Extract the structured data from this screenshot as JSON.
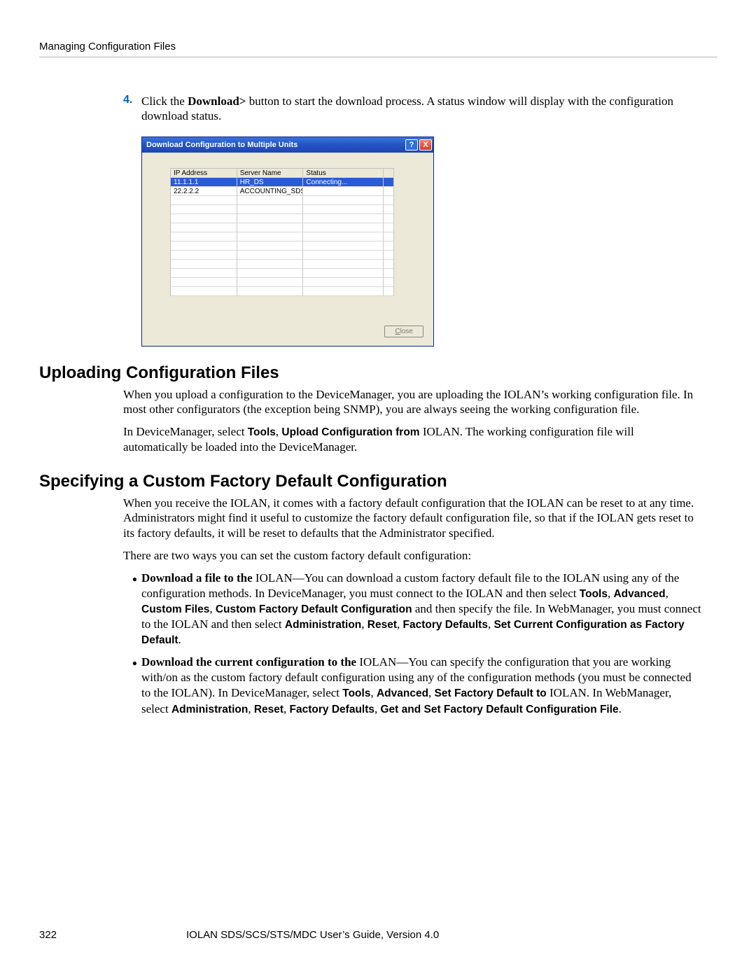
{
  "header": {
    "running": "Managing Configuration Files"
  },
  "step": {
    "num": "4.",
    "text_pre": "Click the ",
    "bold": "Download>",
    "text_post": " button to start the download process. A status window will display with the configuration download status."
  },
  "dialog": {
    "title": "Download Configuration to Multiple Units",
    "help": "?",
    "close_x": "X",
    "cols": {
      "ip": "IP Address",
      "name": "Server Name",
      "status": "Status"
    },
    "rows": [
      {
        "ip": "11.1.1.1",
        "name": "HR_DS",
        "status": "Connecting...",
        "selected": true
      },
      {
        "ip": "22.2.2.2",
        "name": "ACCOUNTING_SDS",
        "status": "",
        "selected": false
      }
    ],
    "blank_rows": 11,
    "close_btn": {
      "mnemonic": "C",
      "rest": "lose"
    }
  },
  "sections": {
    "upload": {
      "heading": "Uploading Configuration Files",
      "p1": "When you upload a configuration to the DeviceManager, you are uploading the IOLAN’s working configuration file. In most other configurators (the exception being SNMP), you are always seeing the working configuration file.",
      "p2_pre": "In DeviceManager, select ",
      "p2_b1": "Tools",
      "p2_comma": ", ",
      "p2_b2": "Upload Configuration from",
      "p2_post": " IOLAN. The working configuration file will automatically be loaded into the DeviceManager."
    },
    "custom": {
      "heading": "Specifying a Custom Factory Default Configuration",
      "p1": "When you receive the IOLAN, it comes with a factory default configuration that the IOLAN can be reset to at any time. Administrators might find it useful to customize the factory default configuration file, so that if the IOLAN gets reset to its factory defaults, it will be reset to defaults that the Administrator specified.",
      "p2": "There are two ways you can set the custom factory default configuration:",
      "bullet1": {
        "lead_b": "Download a file to the ",
        "lead_post": "IOLAN—You can download a custom factory default file to the IOLAN using any of the configuration methods. In DeviceManager, you must connect to the IOLAN and then select ",
        "m1": "Tools",
        "c": ", ",
        "m2": "Advanced",
        "m3": "Custom Files",
        "m4": "Custom Factory Default Configuration",
        "mid": " and then specify the file. In WebManager, you must connect to the IOLAN and then select ",
        "w1": "Administration",
        "w2": "Reset",
        "w3": "Factory Defaults",
        "w4": "Set Current Configuration as Factory Default",
        "end": "."
      },
      "bullet2": {
        "lead_b": "Download the current configuration to the ",
        "lead_post": "IOLAN—You can specify the configuration that you are working with/on as the custom factory default configuration using any of the configuration methods (you must be connected to the IOLAN). In DeviceManager, select ",
        "m1": "Tools",
        "c": ", ",
        "m2": "Advanced",
        "m3": "Set Factory Default to",
        "mid": " IOLAN. In WebManager, select ",
        "w1": "Administration",
        "w2": "Reset",
        "w3": "Factory Defaults",
        "w4": "Get and Set Factory Default Configuration File",
        "end": "."
      }
    }
  },
  "footer": {
    "page": "322",
    "title": "IOLAN SDS/SCS/STS/MDC User’s Guide, Version 4.0"
  }
}
